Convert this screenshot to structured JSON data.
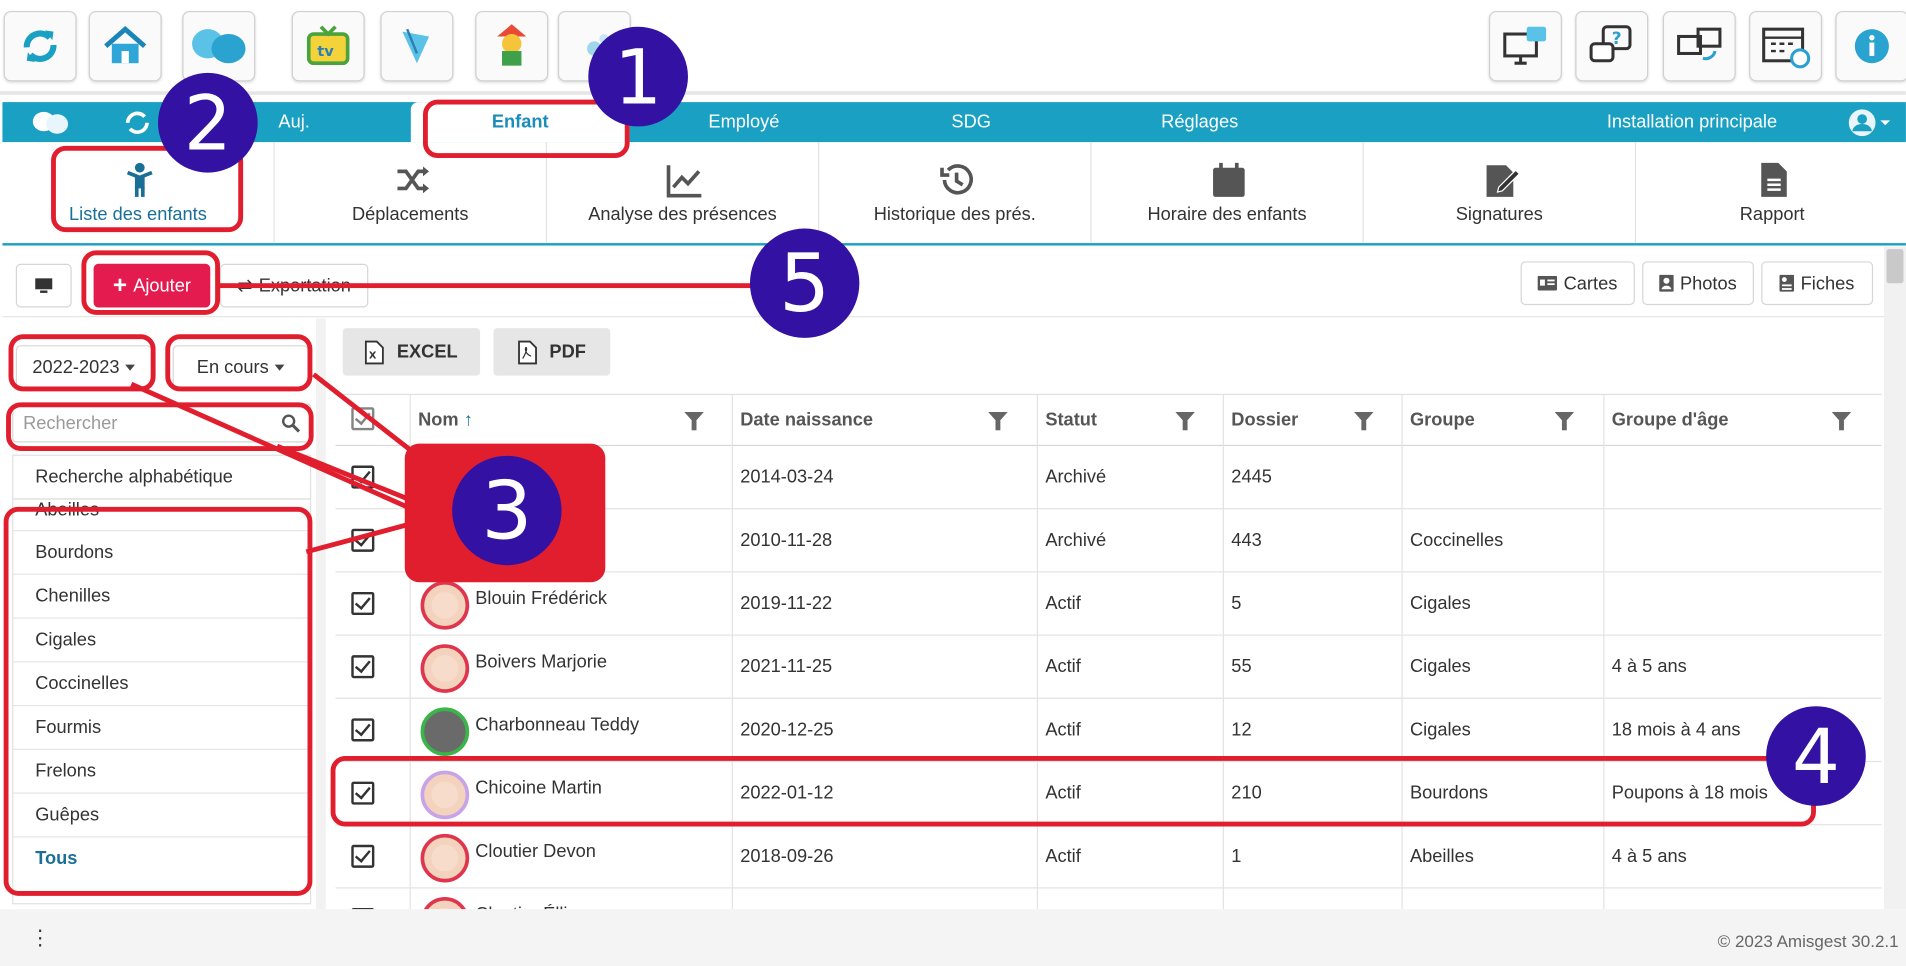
{
  "toolbar_icons": [
    "refresh-icon",
    "home-icon",
    "amisgest-logo-icon",
    "tv-icon",
    "butterfly-icon",
    "clown-icon",
    "bubbles-icon",
    "training-screen-icon",
    "help-chat-icon",
    "sync-screens-icon",
    "calendar-clock-icon",
    "info-icon"
  ],
  "nav": {
    "items": [
      "Auj.",
      "Enfant",
      "Employé",
      "SDG",
      "Réglages"
    ],
    "installation": "Installation principale"
  },
  "subnav": [
    "Liste des enfants",
    "Déplacements",
    "Analyse des présences",
    "Historique des prés.",
    "Horaire des enfants",
    "Signatures",
    "Rapport"
  ],
  "actions": {
    "add": "Ajouter",
    "export": "Exportation",
    "cards": "Cartes",
    "photos": "Photos",
    "sheets": "Fiches"
  },
  "filters": {
    "year": "2022-2023",
    "status": "En cours",
    "search_placeholder": "Rechercher"
  },
  "groups": {
    "alpha": "Recherche alphabétique",
    "items": [
      "Abeilles",
      "Bourdons",
      "Chenilles",
      "Cigales",
      "Coccinelles",
      "Fourmis",
      "Frelons",
      "Guêpes"
    ],
    "all": "Tous"
  },
  "export_buttons": {
    "excel": "EXCEL",
    "pdf": "PDF"
  },
  "table": {
    "headers": [
      "Nom",
      "Date naissance",
      "Statut",
      "Dossier",
      "Groupe",
      "Groupe d'âge"
    ],
    "rows": [
      {
        "name": "",
        "dob": "2014-03-24",
        "status": "Archivé",
        "file": "2445",
        "group": "",
        "age": ""
      },
      {
        "name": "",
        "dob": "2010-11-28",
        "status": "Archivé",
        "file": "443",
        "group": "Coccinelles",
        "age": ""
      },
      {
        "name": "Blouin Frédérick",
        "dob": "2019-11-22",
        "status": "Actif",
        "file": "5",
        "group": "Cigales",
        "age": ""
      },
      {
        "name": "Boivers Marjorie",
        "dob": "2021-11-25",
        "status": "Actif",
        "file": "55",
        "group": "Cigales",
        "age": "4 à 5 ans"
      },
      {
        "name": "Charbonneau Teddy",
        "dob": "2020-12-25",
        "status": "Actif",
        "file": "12",
        "group": "Cigales",
        "age": "18 mois à 4 ans"
      },
      {
        "name": "Chicoine Martin",
        "dob": "2022-01-12",
        "status": "Actif",
        "file": "210",
        "group": "Bourdons",
        "age": "Poupons à 18 mois"
      },
      {
        "name": "Cloutier Devon",
        "dob": "2018-09-26",
        "status": "Actif",
        "file": "1",
        "group": "Abeilles",
        "age": "4 à 5 ans"
      },
      {
        "name": "Cloutier Éllie",
        "dob": "",
        "status": "",
        "file": "",
        "group": "",
        "age": ""
      }
    ]
  },
  "footer": {
    "copyright": "© 2023 Amisgest 30.2.1"
  },
  "annotations": [
    "1",
    "2",
    "3",
    "4",
    "5"
  ],
  "colors": {
    "nav": "#1aa0c3",
    "accent_red": "#e31b4e",
    "annotation": "#e01e2d",
    "badge": "#3311a3"
  }
}
